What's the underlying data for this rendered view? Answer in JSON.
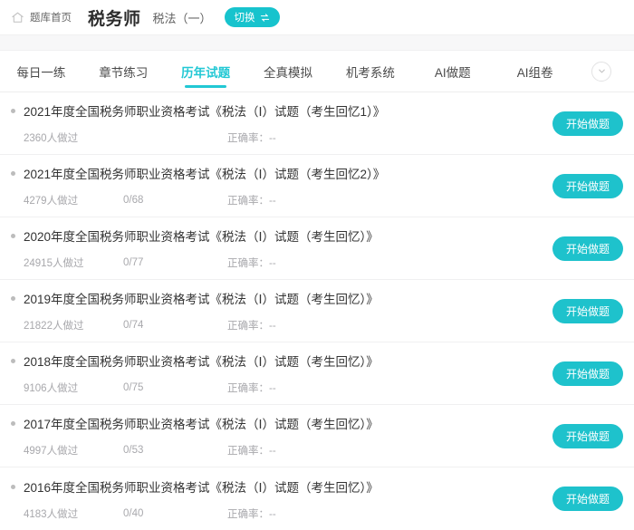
{
  "header": {
    "home_label": "题库首页",
    "home_icon": "home-icon",
    "exam_title": "税务师",
    "subject_name": "税法（一）",
    "switch_label": "切换",
    "switch_icon": "swap-horizontal-icon",
    "accent_color": "#17c3cd"
  },
  "tabs": {
    "items": [
      {
        "label": "每日一练",
        "active": false
      },
      {
        "label": "章节练习",
        "active": false
      },
      {
        "label": "历年试题",
        "active": true
      },
      {
        "label": "全真模拟",
        "active": false
      },
      {
        "label": "机考系统",
        "active": false
      },
      {
        "label": "AI做题",
        "active": false
      },
      {
        "label": "AI组卷",
        "active": false
      }
    ],
    "more_icon": "chevron-down-icon",
    "active_color": "#22c8d4"
  },
  "list": {
    "start_button_label": "开始做题",
    "start_button_color": "#1ec2cc",
    "rate_label": "正确率：",
    "rate_value": "--",
    "rows": [
      {
        "title": "2021年度全国税务师职业资格考试《税法（Ⅰ）试题（考生回忆1）》",
        "users": "2360人做过",
        "progress": "",
        "rate": "正确率：--"
      },
      {
        "title": "2021年度全国税务师职业资格考试《税法（Ⅰ）试题（考生回忆2）》",
        "users": "4279人做过",
        "progress": "0/68",
        "rate": "正确率：--"
      },
      {
        "title": "2020年度全国税务师职业资格考试《税法（Ⅰ）试题（考生回忆）》",
        "users": "24915人做过",
        "progress": "0/77",
        "rate": "正确率：--"
      },
      {
        "title": "2019年度全国税务师职业资格考试《税法（Ⅰ）试题（考生回忆）》",
        "users": "21822人做过",
        "progress": "0/74",
        "rate": "正确率：--"
      },
      {
        "title": "2018年度全国税务师职业资格考试《税法（Ⅰ）试题（考生回忆）》",
        "users": "9106人做过",
        "progress": "0/75",
        "rate": "正确率：--"
      },
      {
        "title": "2017年度全国税务师职业资格考试《税法（Ⅰ）试题（考生回忆）》",
        "users": "4997人做过",
        "progress": "0/53",
        "rate": "正确率：--"
      },
      {
        "title": "2016年度全国税务师职业资格考试《税法（Ⅰ）试题（考生回忆）》",
        "users": "4183人做过",
        "progress": "0/40",
        "rate": "正确率：--"
      }
    ]
  }
}
